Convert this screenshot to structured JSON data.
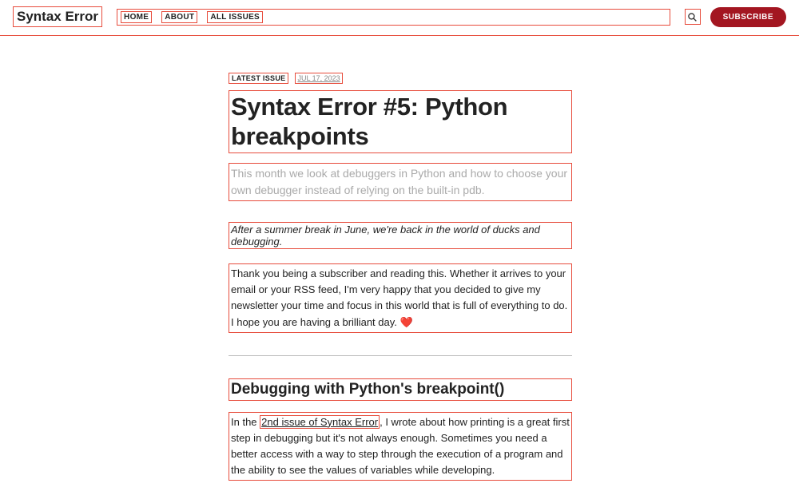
{
  "header": {
    "brand": "Syntax Error",
    "nav": [
      "HOME",
      "ABOUT",
      "ALL ISSUES"
    ],
    "subscribe": "SUBSCRIBE"
  },
  "post": {
    "badge": "LATEST ISSUE",
    "date": "JUL 17, 2023",
    "title": "Syntax Error #5: Python breakpoints",
    "subtitle": "This month we look at debuggers in Python and how to choose your own debugger instead of relying on the built-in pdb.",
    "intro_em": "After a summer break in June, we're back in the world of ducks and debugging.",
    "thanks_pre": "Thank you being a subscriber and reading this. Whether it arrives to your email or your RSS feed, I'm very happy that you decided to give my newsletter your time and focus in this world that is full of everything to do. I hope you are having a brilliant day. ",
    "heart": "❤️",
    "h2": "Debugging with Python's breakpoint()",
    "body2_pre": "In the ",
    "body2_link": "2nd issue of Syntax Error",
    "body2_post": ", I wrote about how printing is a great first step in debugging but it's not always enough. Sometimes you need a better access with a way to step through the execution of a program and the ability to see the values of variables while developing."
  }
}
